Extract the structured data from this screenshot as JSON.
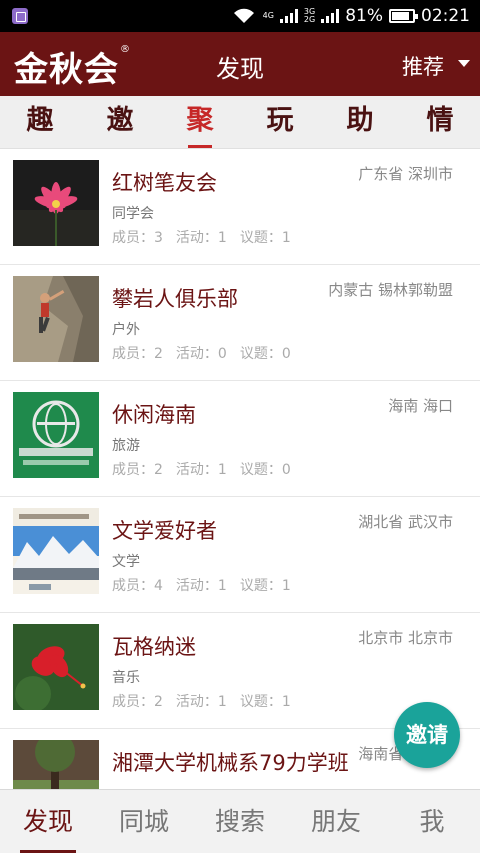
{
  "status_bar": {
    "net_top": "4G",
    "net2_top": "3G",
    "net2_bottom": "2G",
    "battery": "81%",
    "time": "02:21"
  },
  "header": {
    "logo": "金秋会",
    "logo_mark": "®",
    "title": "发现",
    "recommend_label": "推荐",
    "caret_icon": "caret-down-icon",
    "bg_color": "#6b1414"
  },
  "category_tabs": [
    {
      "label": "趣"
    },
    {
      "label": "邀"
    },
    {
      "label": "聚",
      "active": true
    },
    {
      "label": "玩"
    },
    {
      "label": "助"
    },
    {
      "label": "情"
    }
  ],
  "groups": [
    {
      "name": "红树笔友会",
      "location": "广东省 深圳市",
      "category": "同学会",
      "members": "成员：3",
      "activities": "活动：1",
      "topics": "议题：1",
      "image": "pink-flower"
    },
    {
      "name": "攀岩人俱乐部",
      "location": "内蒙古 锡林郭勒盟",
      "category": "户外",
      "members": "成员：2",
      "activities": "活动：0",
      "topics": "议题：0",
      "image": "rock-climber"
    },
    {
      "name": "休闲海南",
      "location": "海南 海口",
      "category": "旅游",
      "members": "成员：2",
      "activities": "活动：1",
      "topics": "议题：0",
      "image": "green-emblem"
    },
    {
      "name": "文学爱好者",
      "location": "湖北省 武汉市",
      "category": "文学",
      "members": "成员：4",
      "activities": "活动：1",
      "topics": "议题：1",
      "image": "snow-mountains"
    },
    {
      "name": "瓦格纳迷",
      "location": "北京市 北京市",
      "category": "音乐",
      "members": "成员：2",
      "activities": "活动：1",
      "topics": "议题：1",
      "image": "red-hibiscus"
    },
    {
      "name": "湘潭大学机械系79力学班",
      "location": "海南省 海口市",
      "category": "",
      "members": "",
      "activities": "",
      "topics": "",
      "image": "tree-lawn"
    }
  ],
  "invite_button": {
    "label": "邀请",
    "color": "#1aa39a"
  },
  "bottom_nav": [
    {
      "label": "发现",
      "active": true
    },
    {
      "label": "同城"
    },
    {
      "label": "搜索"
    },
    {
      "label": "朋友"
    },
    {
      "label": "我"
    }
  ],
  "colors": {
    "accent": "#c62828",
    "brand": "#6b1414",
    "name_text": "#6b1414"
  }
}
